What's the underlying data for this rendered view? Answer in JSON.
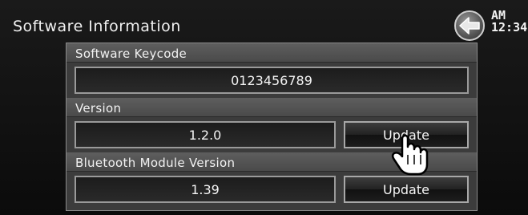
{
  "header": {
    "title": "Software Information",
    "clock_period": "AM",
    "clock_time": "12:34"
  },
  "sections": {
    "keycode": {
      "label": "Software Keycode",
      "value": "0123456789"
    },
    "version": {
      "label": "Version",
      "value": "1.2.0",
      "button": "Update"
    },
    "bluetooth": {
      "label": "Bluetooth Module Version",
      "value": "1.39",
      "button": "Update"
    }
  },
  "icons": {
    "back": "back-arrow-icon",
    "pointer": "hand-pointer-icon"
  },
  "colors": {
    "background": "#111111",
    "panel": "#3a3a3a",
    "text": "#f2f2f2"
  }
}
